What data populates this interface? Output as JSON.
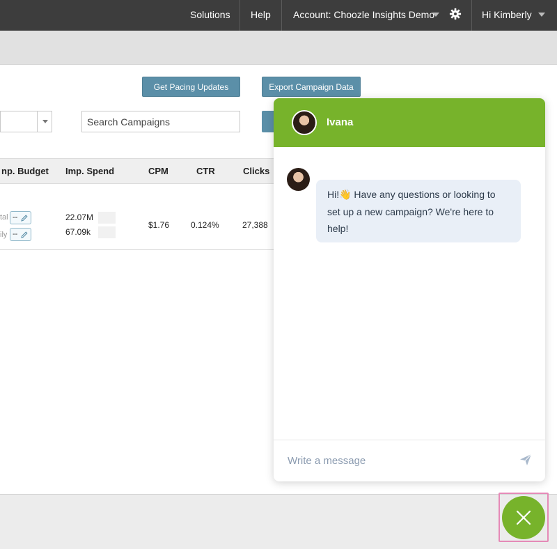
{
  "topnav": {
    "solutions": "Solutions",
    "help": "Help",
    "account_prefix": "Account:",
    "account_name": "Choozle Insights Demo",
    "greeting": "Hi Kimberly",
    "icons": [
      "gear-icon",
      "caret-down-icon"
    ]
  },
  "actions": {
    "pacing_button": "Get Pacing Updates",
    "export_button": "Export Campaign Data"
  },
  "search": {
    "placeholder": "Search Campaigns"
  },
  "table": {
    "columns": [
      "np. Budget",
      "Imp. Spend",
      "CPM",
      "CTR",
      "Clicks"
    ],
    "row": {
      "budget_total_label": "tal",
      "budget_daily_label": "ily",
      "budget_total_value": "--",
      "budget_daily_value": "--",
      "spend_total": "22.07M",
      "spend_daily": "67.09k",
      "cpm": "$1.76",
      "ctr": "0.124%",
      "clicks": "27,388"
    }
  },
  "chat": {
    "agent_name": "Ivana",
    "message": "Hi!👋  Have any questions or looking to set up a new campaign? We're here to help!",
    "input_placeholder": "Write a message",
    "accent_color": "#77b32b",
    "icons": [
      "send-icon",
      "close-icon"
    ]
  }
}
